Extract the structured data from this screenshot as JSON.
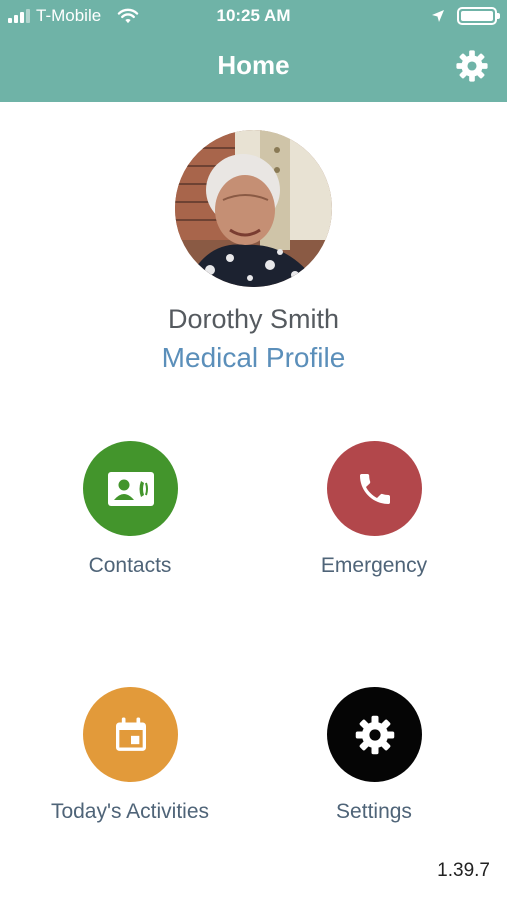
{
  "status_bar": {
    "carrier": "T-Mobile",
    "time": "10:25 AM",
    "icons": [
      "signal-icon",
      "wifi-icon",
      "location-arrow-icon",
      "battery-icon"
    ]
  },
  "header": {
    "title": "Home",
    "settings_icon": "gear-icon",
    "background": "#6fb3a7"
  },
  "profile": {
    "name": "Dorothy Smith",
    "link": "Medical Profile"
  },
  "actions": [
    {
      "label": "Contacts",
      "icon": "contact-card-icon",
      "color": "#43952c"
    },
    {
      "label": "Emergency",
      "icon": "phone-icon",
      "color": "#b2474b"
    },
    {
      "label": "Today's Activities",
      "icon": "calendar-icon",
      "color": "#e29a3a"
    },
    {
      "label": "Settings",
      "icon": "gear-icon",
      "color": "#050505"
    }
  ],
  "footer": {
    "version": "1.39.7"
  }
}
